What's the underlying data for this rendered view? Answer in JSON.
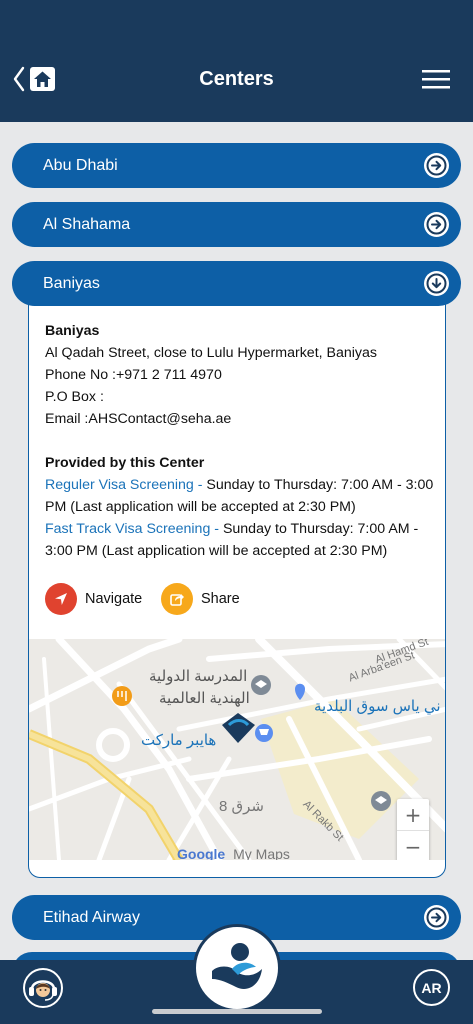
{
  "header": {
    "title": "Centers",
    "background": "#1a3a5c"
  },
  "accordion": [
    {
      "label": "Abu Dhabi",
      "expanded": false
    },
    {
      "label": "Al Shahama",
      "expanded": false
    },
    {
      "label": "Baniyas",
      "expanded": true
    },
    {
      "label": "Etihad Airway",
      "expanded": false
    }
  ],
  "center": {
    "name": "Baniyas",
    "address": "Al Qadah Street, close to Lulu Hypermarket, Baniyas",
    "phone": "Phone No :+971 2 711 4970",
    "po_box": "P.O Box :",
    "email": "Email :AHSContact@seha.ae",
    "services_heading": "Provided by this Center",
    "services": [
      {
        "name": "Reguler Visa Screening -",
        "hours": " Sunday to Thursday: 7:00 AM - 3:00 PM (Last application will be accepted at 2:30 PM)"
      },
      {
        "name": "Fast Track Visa Screening -",
        "hours": " Sunday to Thursday: 7:00 AM - 3:00 PM (Last application will be accepted at 2:30 PM)"
      }
    ],
    "actions": {
      "navigate_label": "Navigate",
      "share_label": "Share"
    }
  },
  "map": {
    "labels": {
      "school_ar_1": "المدرسة الدولية",
      "school_ar_2": "الهندية العالمية",
      "market_ar": "ني ياس سوق البلدية",
      "hyper_ar": "هايبر ماركت",
      "sharq": "شرق 8",
      "al_rakb": "Al Rakb St",
      "arbaeen": "Al Arba'een St",
      "hamd": "Al Hamd St",
      "google": "Google",
      "mymaps": "My Maps"
    },
    "zoom_in": "+",
    "zoom_out": "−"
  },
  "bottombar": {
    "language_button": "AR"
  },
  "colors": {
    "accent": "#0d5fa6",
    "navigate": "#e0432f",
    "share": "#f7a81b",
    "link": "#1b73b9"
  }
}
